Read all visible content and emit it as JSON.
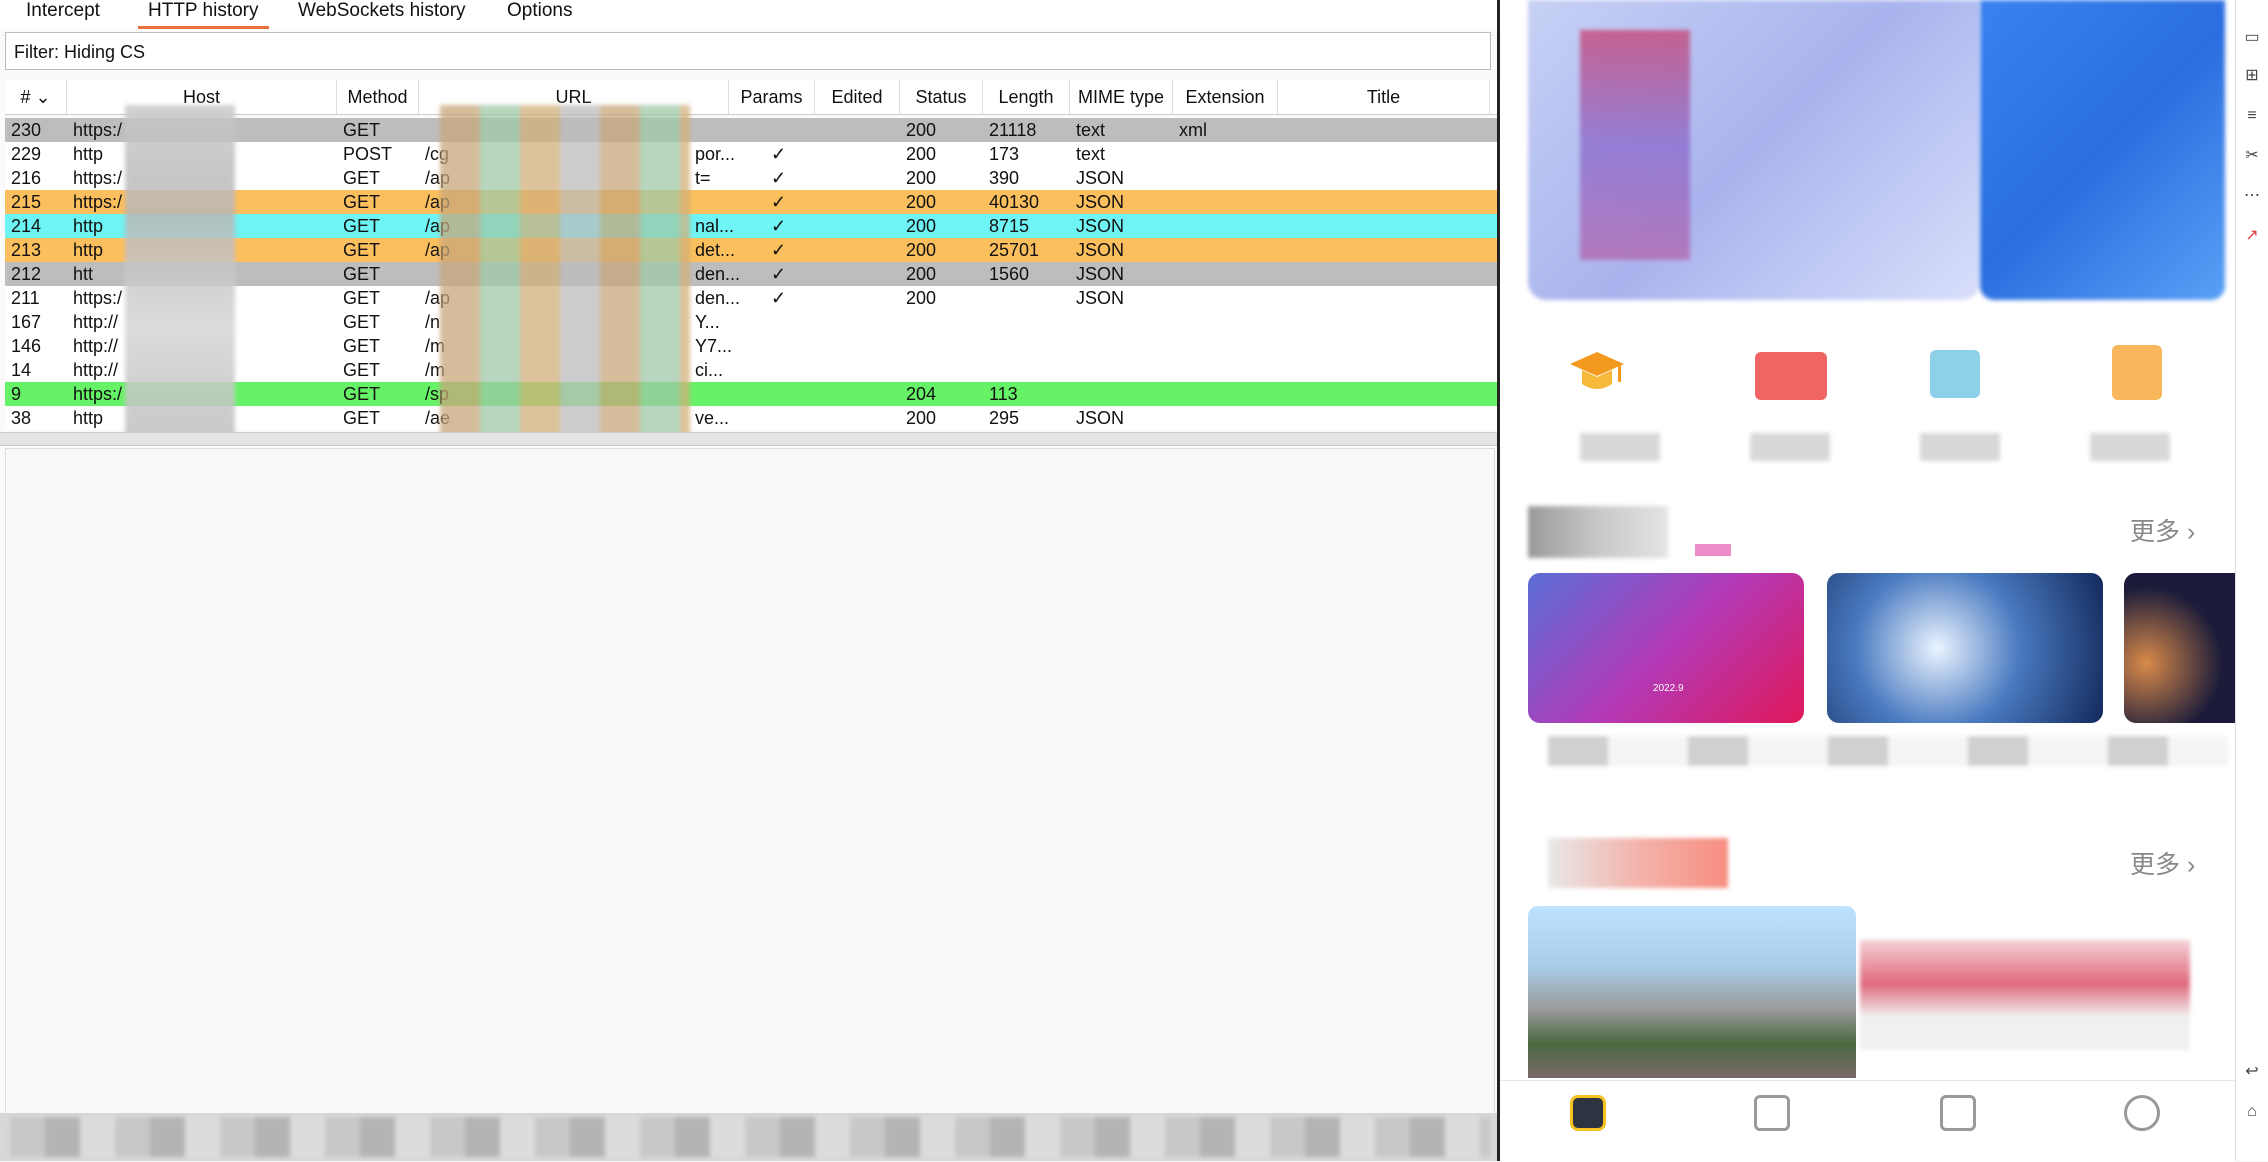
{
  "tabs": [
    "Intercept",
    "HTTP history",
    "WebSockets history",
    "Options"
  ],
  "filter_text": "Filter: Hiding CS",
  "columns": [
    "#",
    "Host",
    "Method",
    "URL",
    "Params",
    "Edited",
    "Status",
    "Length",
    "MIME type",
    "Extension",
    "Title"
  ],
  "rows": [
    {
      "id": "230",
      "host": "https:/",
      "method": "GET",
      "url": "",
      "url_tail": "",
      "params": "",
      "status": "200",
      "length": "21118",
      "mime": "text",
      "ext": "xml",
      "color": "#bdbdbd"
    },
    {
      "id": "229",
      "host": "http",
      "method": "POST",
      "url": "/cg",
      "url_tail": "por...",
      "params": "✓",
      "status": "200",
      "length": "173",
      "mime": "text",
      "ext": "",
      "color": "#ffffff"
    },
    {
      "id": "216",
      "host": "https:/",
      "method": "GET",
      "url": "/ap",
      "url_tail": "t=",
      "params": "✓",
      "status": "200",
      "length": "390",
      "mime": "JSON",
      "ext": "",
      "color": "#ffffff"
    },
    {
      "id": "215",
      "host": "https:/",
      "method": "GET",
      "url": "/ap",
      "url_tail": "",
      "params": "✓",
      "status": "200",
      "length": "40130",
      "mime": "JSON",
      "ext": "",
      "color": "#fcbf5e"
    },
    {
      "id": "214",
      "host": "http",
      "method": "GET",
      "url": "/ap",
      "url_tail": "nal...",
      "params": "✓",
      "status": "200",
      "length": "8715",
      "mime": "JSON",
      "ext": "",
      "color": "#6ef4f4"
    },
    {
      "id": "213",
      "host": "http",
      "method": "GET",
      "url": "/ap",
      "url_tail": "det...",
      "params": "✓",
      "status": "200",
      "length": "25701",
      "mime": "JSON",
      "ext": "",
      "color": "#fcbf5e"
    },
    {
      "id": "212",
      "host": "htt",
      "method": "GET",
      "url": "",
      "url_tail": "den...",
      "params": "✓",
      "status": "200",
      "length": "1560",
      "mime": "JSON",
      "ext": "",
      "color": "#bdbdbd"
    },
    {
      "id": "211",
      "host": "https:/",
      "method": "GET",
      "url": "/ap",
      "url_tail": "den...",
      "params": "✓",
      "status": "200",
      "length": "",
      "mime": "JSON",
      "ext": "",
      "color": "#ffffff"
    },
    {
      "id": "167",
      "host": "http://",
      "method": "GET",
      "url": "/n",
      "url_tail": "Y...",
      "params": "",
      "status": "",
      "length": "",
      "mime": "",
      "ext": "",
      "color": "#ffffff"
    },
    {
      "id": "146",
      "host": "http://",
      "method": "GET",
      "url": "/m",
      "url_tail": "Y7...",
      "params": "",
      "status": "",
      "length": "",
      "mime": "",
      "ext": "",
      "color": "#ffffff"
    },
    {
      "id": "14",
      "host": "http://",
      "method": "GET",
      "url": "/m",
      "url_tail": "ci...",
      "params": "",
      "status": "",
      "length": "",
      "mime": "",
      "ext": "",
      "color": "#ffffff"
    },
    {
      "id": "9",
      "host": "https:/",
      "method": "GET",
      "url": "/sp",
      "url_tail": "",
      "params": "",
      "status": "204",
      "length": "113",
      "mime": "",
      "ext": "",
      "color": "#66f266"
    },
    {
      "id": "38",
      "host": "http",
      "method": "GET",
      "url": "/ae",
      "url_tail": "ve...",
      "params": "",
      "status": "200",
      "length": "295",
      "mime": "JSON",
      "ext": "",
      "color": "#ffffff"
    }
  ],
  "phone": {
    "more_1": "更多",
    "more_2": "更多",
    "card1_text": "2022.9"
  },
  "colors": {
    "tab_underline": "#e8703a",
    "orange": "#fcbf5e",
    "cyan": "#6ef4f4",
    "green": "#66f266",
    "gray": "#bdbdbd"
  }
}
